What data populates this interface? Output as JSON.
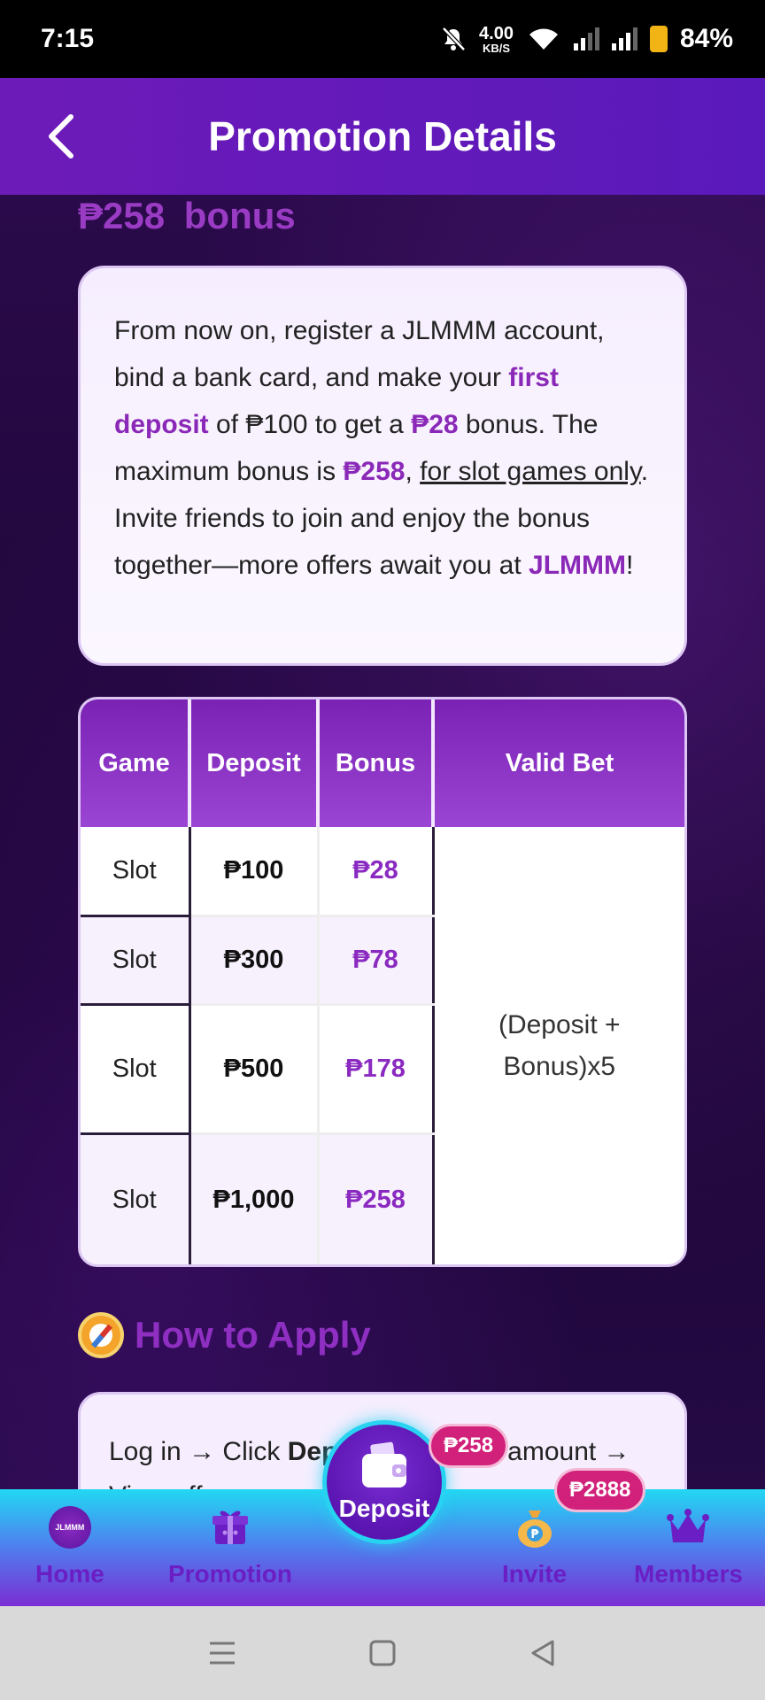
{
  "status_bar": {
    "time": "7:15",
    "net_speed_value": "4.00",
    "net_speed_unit": "KB/S",
    "battery": "84%"
  },
  "header": {
    "title": "Promotion Details"
  },
  "promo": {
    "bonus_title": "₱258  bonus",
    "desc": {
      "p1": "From now on, register a JLMMM account, bind a bank card, and make your ",
      "first_deposit": "first deposit",
      "p2": " of ₱100 to get a ",
      "bonus_amt": "₱28",
      "p3": " bonus. The maximum bonus is ",
      "max_bonus": "₱258",
      "p4": ", ",
      "slot_only": "for slot games only",
      "p5": ". Invite friends to join and enjoy the bonus together—more offers await you at ",
      "brand": "JLMMM",
      "p6": "!"
    },
    "table": {
      "headers": [
        "Game",
        "Deposit",
        "Bonus",
        "Valid Bet"
      ],
      "rows": [
        {
          "game": "Slot",
          "deposit": "₱100",
          "bonus": "₱28"
        },
        {
          "game": "Slot",
          "deposit": "₱300",
          "bonus": "₱78"
        },
        {
          "game": "Slot",
          "deposit": "₱500",
          "bonus": "₱178"
        },
        {
          "game": "Slot",
          "deposit": "₱1,000",
          "bonus": "₱258"
        }
      ],
      "valid_bet": "(Deposit + Bonus)x5"
    },
    "how_to_apply": {
      "title": "How to Apply",
      "step_a": "Log in → Click ",
      "step_bold": "Deposit",
      "step_b": " → Select amount →",
      "step_c": "View offer"
    }
  },
  "bottom_nav": {
    "home": "Home",
    "home_logo": "JLMMM",
    "promotion": "Promotion",
    "deposit": "Deposit",
    "deposit_badge": "₱258",
    "invite": "Invite",
    "invite_badge": "₱2888",
    "members": "Members"
  },
  "colors": {
    "header": "#6d1bb8",
    "accent": "#8a28b8",
    "badge": "#d1217a"
  }
}
